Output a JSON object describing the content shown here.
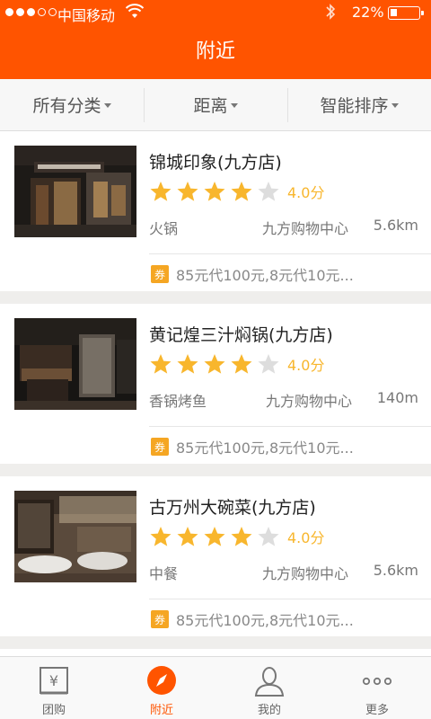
{
  "status_bar": {
    "carrier": "中国移动",
    "battery_text": "22%",
    "battery_level": 0.22
  },
  "nav": {
    "title": "附近"
  },
  "filters": [
    {
      "label": "所有分类"
    },
    {
      "label": "距离"
    },
    {
      "label": "智能排序"
    }
  ],
  "shops": [
    {
      "name": "锦城印象(九方店)",
      "rating_text": "4.0分",
      "stars_filled": 4,
      "category": "火锅",
      "area": "九方购物中心",
      "distance": "5.6km",
      "deal_badge": "券",
      "deal": "85元代100元,8元代10元..."
    },
    {
      "name": "黄记煌三汁焖锅(九方店)",
      "rating_text": "4.0分",
      "stars_filled": 4,
      "category": "香锅烤鱼",
      "area": "九方购物中心",
      "distance": "140m",
      "deal_badge": "券",
      "deal": "85元代100元,8元代10元..."
    },
    {
      "name": "古万州大碗菜(九方店)",
      "rating_text": "4.0分",
      "stars_filled": 4,
      "category": "中餐",
      "area": "九方购物中心",
      "distance": "5.6km",
      "deal_badge": "券",
      "deal": "85元代100元,8元代10元..."
    }
  ],
  "tabs": [
    {
      "label": "团购",
      "icon": "coupon-yen-icon"
    },
    {
      "label": "附近",
      "icon": "compass-icon",
      "active": true
    },
    {
      "label": "我的",
      "icon": "user-icon"
    },
    {
      "label": "更多",
      "icon": "more-dots-icon"
    }
  ],
  "colors": {
    "brand": "#ff5400",
    "star": "#f8b62d",
    "badge": "#f5a623"
  }
}
